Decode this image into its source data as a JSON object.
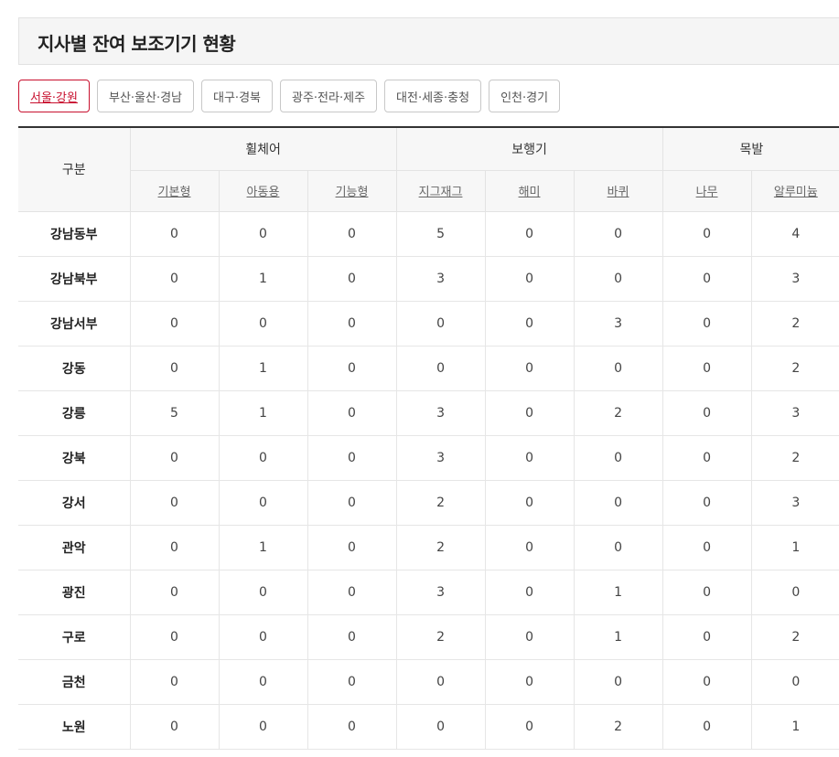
{
  "header": {
    "title": "지사별 잔여 보조기기 현황"
  },
  "tabs": [
    {
      "label": "서울·강원",
      "active": true
    },
    {
      "label": "부산·울산·경남",
      "active": false
    },
    {
      "label": "대구·경북",
      "active": false
    },
    {
      "label": "광주·전라·제주",
      "active": false
    },
    {
      "label": "대전·세종·충청",
      "active": false
    },
    {
      "label": "인천·경기",
      "active": false
    }
  ],
  "colors": {
    "accent": "#c8102e",
    "header_bg": "#f7f7f7",
    "title_bg": "#f5f5f5"
  },
  "table": {
    "row_header": "구분",
    "groups": [
      {
        "label": "휠체어",
        "columns": [
          "기본형",
          "아동용",
          "기능형"
        ]
      },
      {
        "label": "보행기",
        "columns": [
          "지그재그",
          "해미",
          "바퀴"
        ]
      },
      {
        "label": "목발",
        "columns": [
          "나무",
          "알루미늄"
        ]
      }
    ],
    "rows": [
      {
        "label": "강남동부",
        "values": [
          "0",
          "0",
          "0",
          "5",
          "0",
          "0",
          "0",
          "4"
        ]
      },
      {
        "label": "강남북부",
        "values": [
          "0",
          "1",
          "0",
          "3",
          "0",
          "0",
          "0",
          "3"
        ]
      },
      {
        "label": "강남서부",
        "values": [
          "0",
          "0",
          "0",
          "0",
          "0",
          "3",
          "0",
          "2"
        ]
      },
      {
        "label": "강동",
        "values": [
          "0",
          "1",
          "0",
          "0",
          "0",
          "0",
          "0",
          "2"
        ]
      },
      {
        "label": "강릉",
        "values": [
          "5",
          "1",
          "0",
          "3",
          "0",
          "2",
          "0",
          "3"
        ]
      },
      {
        "label": "강북",
        "values": [
          "0",
          "0",
          "0",
          "3",
          "0",
          "0",
          "0",
          "2"
        ]
      },
      {
        "label": "강서",
        "values": [
          "0",
          "0",
          "0",
          "2",
          "0",
          "0",
          "0",
          "3"
        ]
      },
      {
        "label": "관악",
        "values": [
          "0",
          "1",
          "0",
          "2",
          "0",
          "0",
          "0",
          "1"
        ]
      },
      {
        "label": "광진",
        "values": [
          "0",
          "0",
          "0",
          "3",
          "0",
          "1",
          "0",
          "0"
        ]
      },
      {
        "label": "구로",
        "values": [
          "0",
          "0",
          "0",
          "2",
          "0",
          "1",
          "0",
          "2"
        ]
      },
      {
        "label": "금천",
        "values": [
          "0",
          "0",
          "0",
          "0",
          "0",
          "0",
          "0",
          "0"
        ]
      },
      {
        "label": "노원",
        "values": [
          "0",
          "0",
          "0",
          "0",
          "0",
          "2",
          "0",
          "1"
        ]
      }
    ]
  }
}
